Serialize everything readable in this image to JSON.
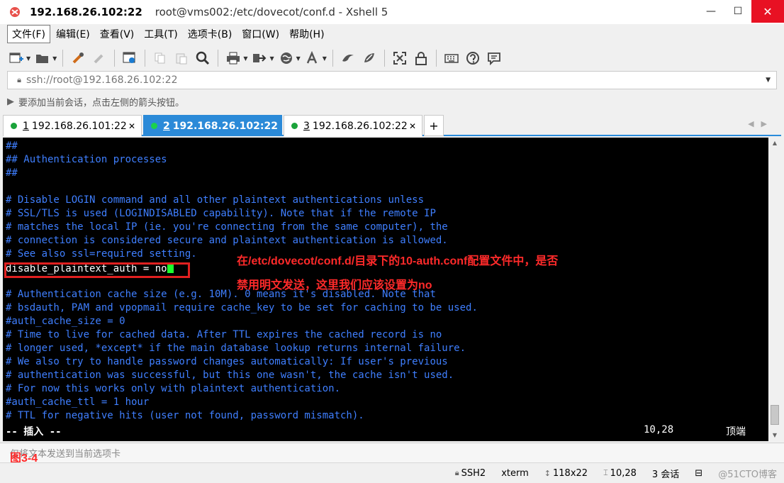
{
  "window": {
    "host": "192.168.26.102:22",
    "path": "root@vms002:/etc/dovecot/conf.d - Xshell 5",
    "min": "—",
    "max": "☐",
    "close": "✕"
  },
  "menu": [
    "文件(F)",
    "编辑(E)",
    "查看(V)",
    "工具(T)",
    "选项卡(B)",
    "窗口(W)",
    "帮助(H)"
  ],
  "toolbar": {
    "icons": [
      "new-session-icon",
      "open-folder-icon",
      "reconnect-icon",
      "disconnect-icon",
      "properties-icon",
      "copy-icon",
      "paste-icon",
      "find-icon",
      "print-icon",
      "transfer-icon",
      "globe-icon",
      "font-icon",
      "xftp-icon",
      "xmanager-icon",
      "fullscreen-icon",
      "lock-icon",
      "keyboard-icon",
      "help-icon",
      "chat-icon"
    ]
  },
  "address": {
    "value": "ssh://root@192.168.26.102:22"
  },
  "hint": "要添加当前会话，点击左侧的箭头按钮。",
  "tabs": [
    {
      "num": "1",
      "label": "192.168.26.101:22",
      "active": false
    },
    {
      "num": "2",
      "label": "192.168.26.102:22",
      "active": true
    },
    {
      "num": "3",
      "label": "192.168.26.102:22",
      "active": false
    }
  ],
  "terminal": {
    "lines": [
      {
        "text": "##",
        "kind": "comment"
      },
      {
        "text": "## Authentication processes",
        "kind": "comment"
      },
      {
        "text": "##",
        "kind": "comment"
      },
      {
        "text": "",
        "kind": "comment"
      },
      {
        "text": "# Disable LOGIN command and all other plaintext authentications unless",
        "kind": "comment"
      },
      {
        "text": "# SSL/TLS is used (LOGINDISABLED capability). Note that if the remote IP",
        "kind": "comment"
      },
      {
        "text": "# matches the local IP (ie. you're connecting from the same computer), the",
        "kind": "comment"
      },
      {
        "text": "# connection is considered secure and plaintext authentication is allowed.",
        "kind": "comment"
      },
      {
        "text": "# See also ssl=required setting.",
        "kind": "comment"
      },
      {
        "text": "disable_plaintext_auth = no",
        "kind": "plain"
      },
      {
        "text": "",
        "kind": "comment"
      },
      {
        "text": "# Authentication cache size (e.g. 10M). 0 means it's disabled. Note that",
        "kind": "comment"
      },
      {
        "text": "# bsdauth, PAM and vpopmail require cache_key to be set for caching to be used.",
        "kind": "comment"
      },
      {
        "text": "#auth_cache_size = 0",
        "kind": "comment"
      },
      {
        "text": "# Time to live for cached data. After TTL expires the cached record is no",
        "kind": "comment"
      },
      {
        "text": "# longer used, *except* if the main database lookup returns internal failure.",
        "kind": "comment"
      },
      {
        "text": "# We also try to handle password changes automatically: If user's previous",
        "kind": "comment"
      },
      {
        "text": "# authentication was successful, but this one wasn't, the cache isn't used.",
        "kind": "comment"
      },
      {
        "text": "# For now this works only with plaintext authentication.",
        "kind": "comment"
      },
      {
        "text": "#auth_cache_ttl = 1 hour",
        "kind": "comment"
      },
      {
        "text": "# TTL for negative hits (user not found, password mismatch).",
        "kind": "comment"
      }
    ],
    "mode": "-- 插入 --",
    "position": "10,28",
    "scroll": "顶端"
  },
  "annotation": {
    "line1": "在/etc/dovecot/conf.d/目录下的10-auth.conf配置文件中，是否",
    "line2": "禁用明文发送，这里我们应该设置为no"
  },
  "sendbar": {
    "text": "仅将文本发送到当前选项卡",
    "figure": "图3-4"
  },
  "status": {
    "protocol": "SSH2",
    "term": "xterm",
    "size": "118x22",
    "cursor": "10,28",
    "sessions": "3 会话",
    "watermark": "@51CTO博客"
  }
}
